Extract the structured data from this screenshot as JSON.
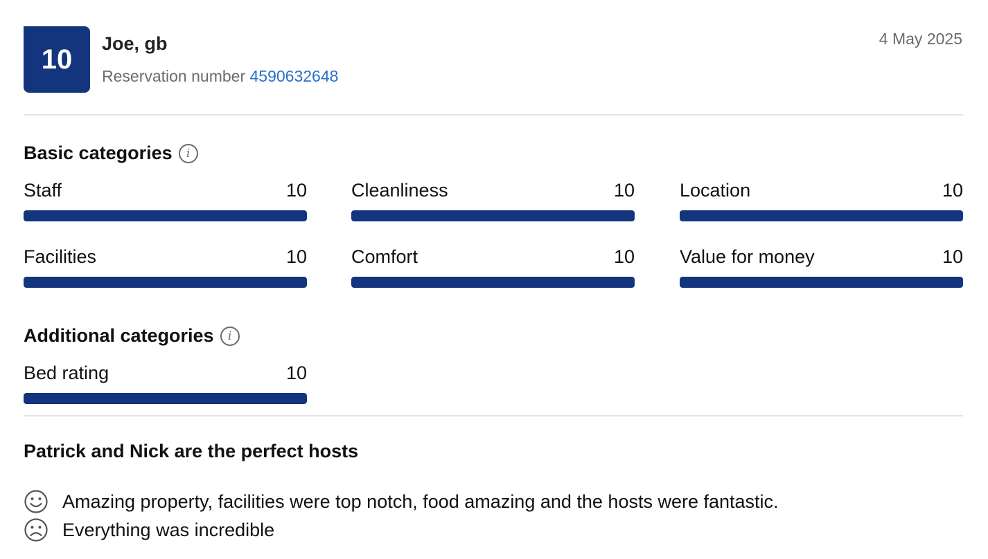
{
  "review": {
    "score": "10",
    "reviewer": "Joe, gb",
    "reservation_label": "Reservation number",
    "reservation_number": "4590632648",
    "date": "4 May 2025"
  },
  "basic": {
    "title": "Basic categories",
    "categories": [
      {
        "label": "Staff",
        "score": "10",
        "fraction": 1.0
      },
      {
        "label": "Cleanliness",
        "score": "10",
        "fraction": 1.0
      },
      {
        "label": "Location",
        "score": "10",
        "fraction": 1.0
      },
      {
        "label": "Facilities",
        "score": "10",
        "fraction": 1.0
      },
      {
        "label": "Comfort",
        "score": "10",
        "fraction": 1.0
      },
      {
        "label": "Value for money",
        "score": "10",
        "fraction": 1.0
      }
    ]
  },
  "additional": {
    "title": "Additional categories",
    "categories": [
      {
        "label": "Bed rating",
        "score": "10",
        "fraction": 1.0
      }
    ]
  },
  "text": {
    "title": "Patrick and Nick are the perfect hosts",
    "positive": "Amazing property, facilities were top notch, food amazing and the hosts were fantastic.",
    "negative": "Everything was incredible"
  },
  "icons": {
    "info": "info-icon",
    "positive": "smiley-face-icon",
    "negative": "sad-face-icon"
  },
  "colors": {
    "accent": "#12357d",
    "link": "#2a6fc9",
    "muted": "#6b6b6b"
  }
}
